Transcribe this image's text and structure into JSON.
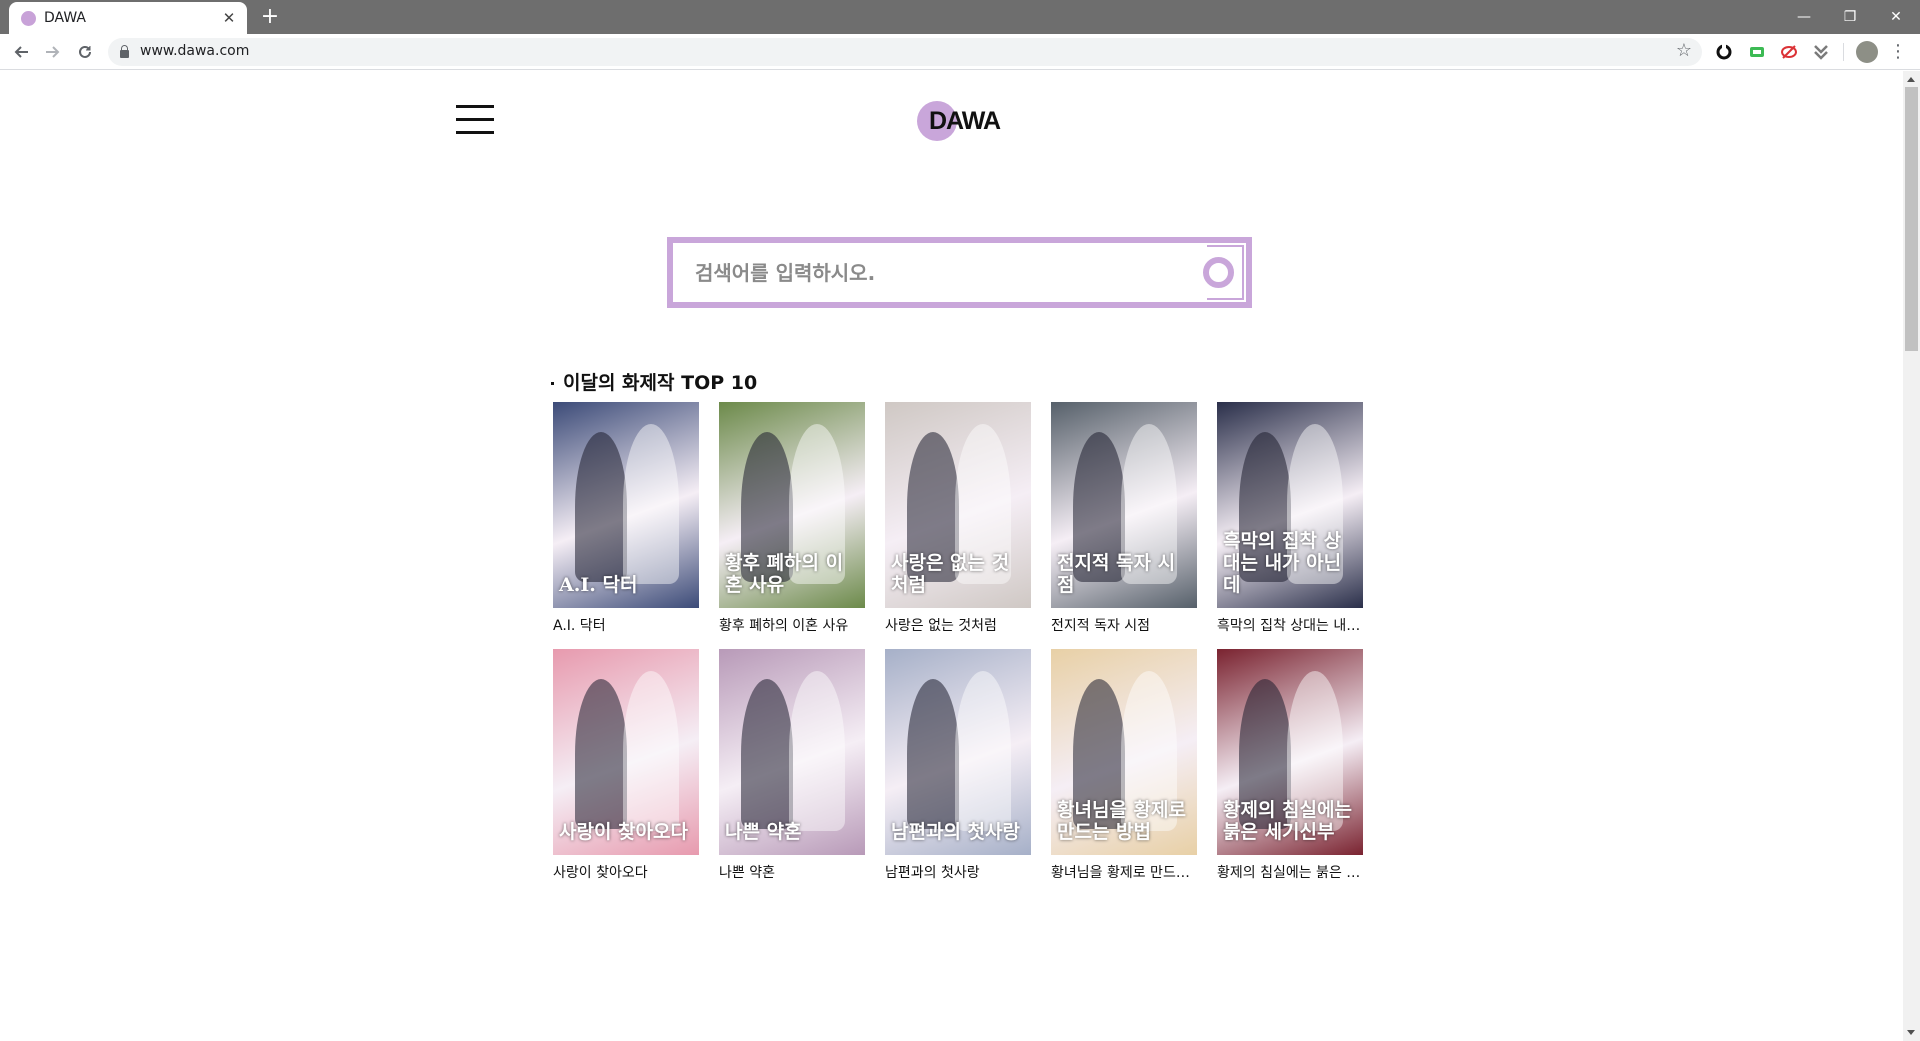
{
  "browser": {
    "tab_title": "DAWA",
    "tab_close": "✕",
    "new_tab": "+",
    "url": "www.dawa.com",
    "window_minimize": "—",
    "window_restore": "❐",
    "window_close": "✕"
  },
  "site": {
    "logo_text": "DAWA",
    "search_placeholder": "검색어를 입력하시오.",
    "section_title": "이달의 화제작 TOP 10",
    "accent_color": "#c9a6da"
  },
  "top10": [
    {
      "label": "A.I. 닥터",
      "cover_text": "A.I. 닥터",
      "bg": "#3c4b78"
    },
    {
      "label": "황후 폐하의 이혼 사유",
      "cover_text": "황후 폐하의 이혼 사유",
      "bg": "#6c8a4a"
    },
    {
      "label": "사랑은 없는 것처럼",
      "cover_text": "사랑은 없는 것처럼",
      "bg": "#cfc8c4"
    },
    {
      "label": "전지적 독자 시점",
      "cover_text": "전지적 독자 시점",
      "bg": "#56606a"
    },
    {
      "label": "흑막의 집착 상대는 내가 아닌데",
      "cover_text": "흑막의 집착 상대는 내가 아닌데",
      "bg": "#2a2f4a"
    },
    {
      "label": "사랑이 찾아오다",
      "cover_text": "사랑이 찾아오다",
      "bg": "#e79aae"
    },
    {
      "label": "나쁜 약혼",
      "cover_text": "나쁜 약혼",
      "bg": "#b89ab8"
    },
    {
      "label": "남편과의 첫사랑",
      "cover_text": "남편과의 첫사랑",
      "bg": "#a6b0c8"
    },
    {
      "label": "황녀님을 황제로 만드는 방법",
      "cover_text": "황녀님을 황제로 만드는 방법",
      "bg": "#e8d0a6"
    },
    {
      "label": "황제의 침실에는 붉은 세기신부",
      "cover_text": "황제의 침실에는 붉은 세기신부",
      "bg": "#7a2330"
    }
  ]
}
